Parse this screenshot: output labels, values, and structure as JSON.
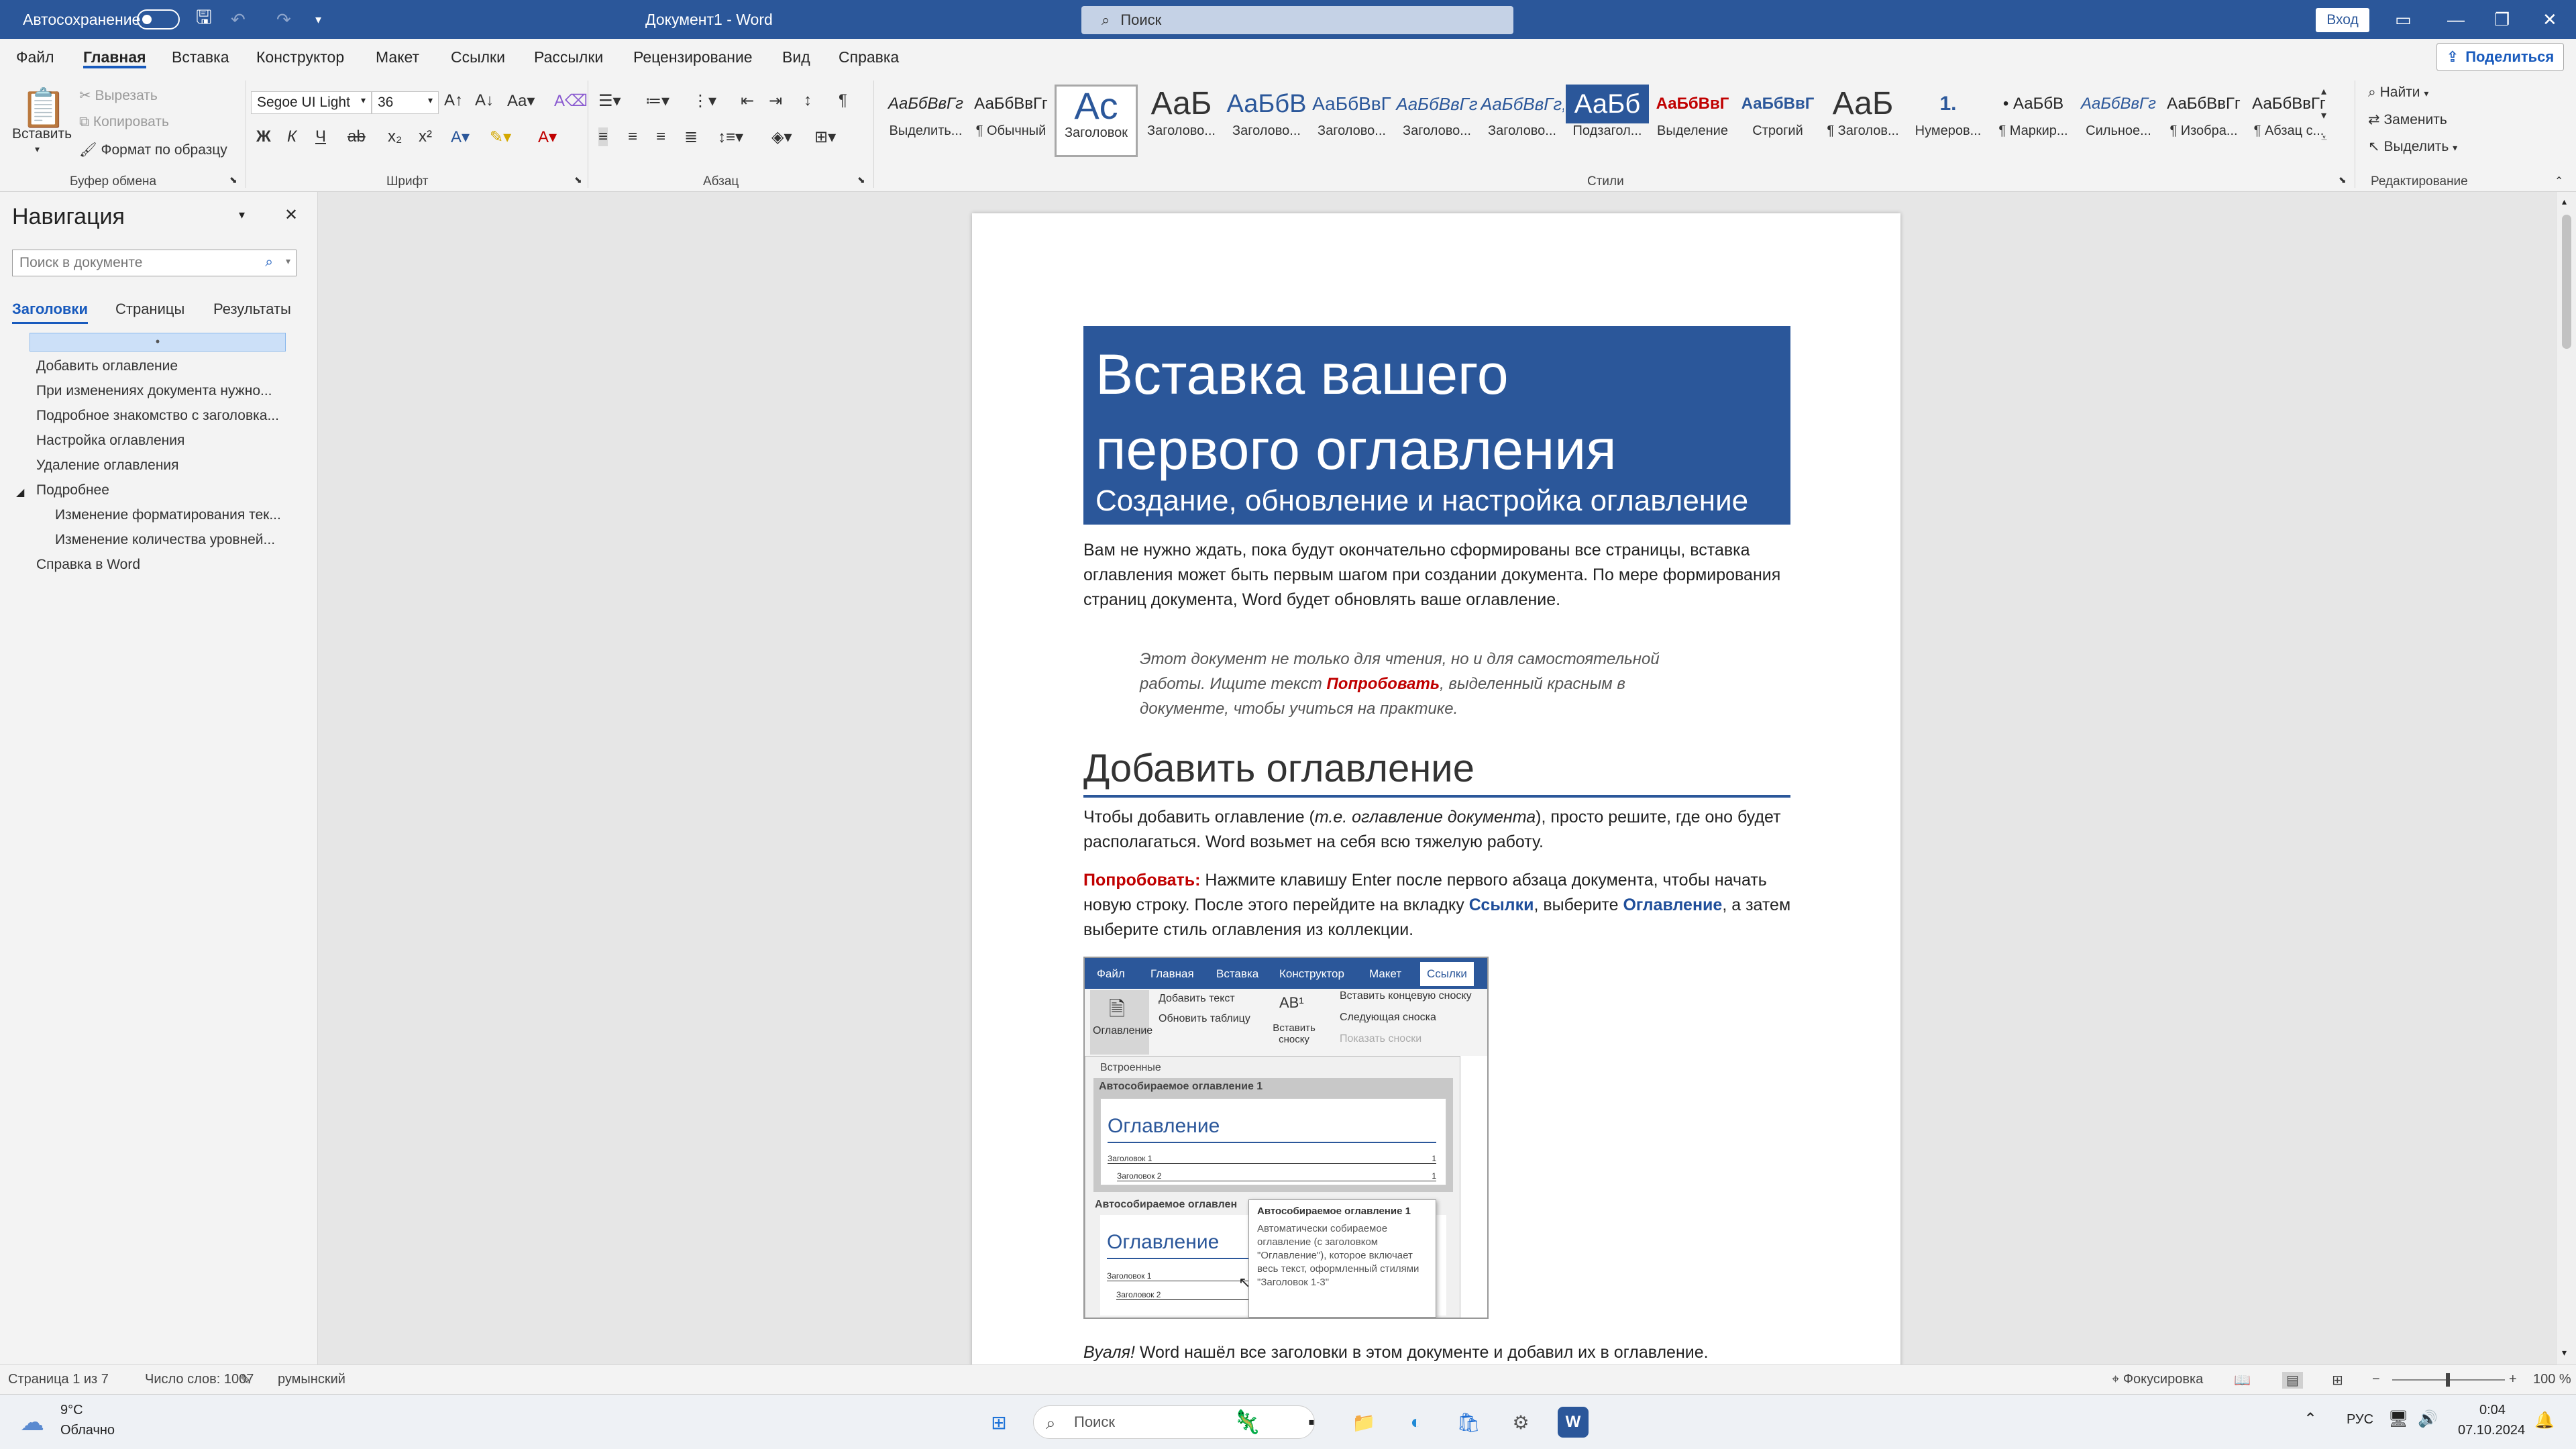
{
  "titlebar": {
    "autosave_label": "Автосохранение",
    "doc_title": "Документ1 - Word",
    "search_placeholder": "Поиск",
    "signin_label": "Вход"
  },
  "menu": {
    "tabs": [
      "Файл",
      "Главная",
      "Вставка",
      "Конструктор",
      "Макет",
      "Ссылки",
      "Рассылки",
      "Рецензирование",
      "Вид",
      "Справка"
    ],
    "active_tab": "Главная",
    "share_label": "Поделиться"
  },
  "ribbon": {
    "clipboard": {
      "paste": "Вставить",
      "cut": "Вырезать",
      "copy": "Копировать",
      "format_painter": "Формат по образцу",
      "group_label": "Буфер обмена"
    },
    "font": {
      "font_name": "Segoe UI Light",
      "font_size": "36",
      "group_label": "Шрифт"
    },
    "paragraph": {
      "group_label": "Абзац"
    },
    "styles": {
      "group_label": "Стили",
      "items": [
        {
          "preview": "АаБбВвГг",
          "name": "Выделить..."
        },
        {
          "preview": "АаБбВвГг",
          "name": "¶ Обычный"
        },
        {
          "preview": "Ac",
          "name": "Заголовок"
        },
        {
          "preview": "АаБ",
          "name": "Заголово..."
        },
        {
          "preview": "АаБбВ",
          "name": "Заголово..."
        },
        {
          "preview": "АаБбВвГ",
          "name": "Заголово..."
        },
        {
          "preview": "АаБбВвГг",
          "name": "Заголово..."
        },
        {
          "preview": "АаБбВвГг,",
          "name": "Заголово..."
        },
        {
          "preview": "АаБб",
          "name": "Подзагол..."
        },
        {
          "preview": "АаБбВвГ",
          "name": "Выделение"
        },
        {
          "preview": "АаБбВвГ",
          "name": "Строгий"
        },
        {
          "preview": "АаБ",
          "name": "¶ Заголов..."
        },
        {
          "preview": "1.",
          "name": "Нумеров..."
        },
        {
          "preview": "• АаБбВ",
          "name": "¶ Маркир..."
        },
        {
          "preview": "АаБбВвГг",
          "name": "Сильное..."
        },
        {
          "preview": "АаБбВвГг",
          "name": "¶ Изобра..."
        },
        {
          "preview": "АаБбВвГг",
          "name": "¶ Абзац с..."
        }
      ]
    },
    "editing": {
      "find": "Найти",
      "replace": "Заменить",
      "select": "Выделить",
      "group_label": "Редактирование"
    }
  },
  "nav": {
    "title": "Навигация",
    "search_placeholder": "Поиск в документе",
    "tabs": [
      "Заголовки",
      "Страницы",
      "Результаты"
    ],
    "selected_marker": "•",
    "items": [
      {
        "label": "Добавить оглавление",
        "level": 1
      },
      {
        "label": "При изменениях документа нужно...",
        "level": 1
      },
      {
        "label": "Подробное знакомство с заголовка...",
        "level": 1
      },
      {
        "label": "Настройка оглавления",
        "level": 1
      },
      {
        "label": "Удаление оглавления",
        "level": 1
      },
      {
        "label": "Подробнее",
        "level": 1
      },
      {
        "label": "Изменение форматирования тек...",
        "level": 2
      },
      {
        "label": "Изменение количества уровней...",
        "level": 2
      },
      {
        "label": "Справка в Word",
        "level": 1
      }
    ]
  },
  "doc": {
    "hero_line1": "Вставка вашего",
    "hero_line2": "первого оглавления",
    "hero_sub": "Создание, обновление и настройка оглавление",
    "intro": "Вам не нужно ждать, пока будут окончательно сформированы все страницы, вставка оглавления может быть первым шагом при создании документа. По мере формирования страниц документа, Word будет обновлять ваше оглавление.",
    "quote_before": "Этот документ не только для чтения, но и для самостоятельной работы. Ищите текст ",
    "quote_highlight": "Попробовать",
    "quote_after": ", выделенный красным в документе, чтобы учиться на практике.",
    "h1": "Добавить оглавление",
    "p1_a": "Чтобы добавить оглавление (",
    "p1_italic": "т.е. оглавление документа",
    "p1_b": "), просто решите, где оно будет располагаться. Word возьмет на себя всю тяжелую работу.",
    "try_label": "Попробовать:",
    "p2_a": " Нажмите клавишу Enter после первого абзаца документа, чтобы начать новую строку. После этого перейдите на вкладку ",
    "p2_link1": "Ссылки",
    "p2_b": ", выберите ",
    "p2_link2": "Оглавление",
    "p2_c": ", а затем выберите стиль оглавления из коллекции.",
    "voila_italic": "Вуаля!",
    "voila_rest": " Word нашёл все заголовки в этом документе и добавил их в оглавление."
  },
  "shot": {
    "tabs": [
      "Файл",
      "Главная",
      "Вставка",
      "Конструктор",
      "Макет",
      "Ссылки"
    ],
    "toc_btn": "Оглавление",
    "add_text": "Добавить текст",
    "update_table": "Обновить таблицу",
    "insert_footnote": "Вставить сноску",
    "insert_endnote": "Вставить концевую сноску",
    "next_footnote": "Следующая сноска",
    "show_notes": "Показать сноски",
    "builtin": "Встроенные",
    "auto1": "Автособираемое оглавление 1",
    "auto2": "Автособираемое оглавлен",
    "toc_heading": "Оглавление",
    "h1_line": "Заголовок 1",
    "h2_line": "Заголовок 2",
    "page_num": "1",
    "tooltip_title": "Автособираемое оглавление 1",
    "tooltip_body": "Автоматически собираемое оглавление (с заголовком \"Оглавление\"), которое включает весь текст, оформленный стилями \"Заголовок 1-3\""
  },
  "status": {
    "page": "Страница 1 из 7",
    "words": "Число слов: 1007",
    "language": "румынский",
    "focus": "Фокусировка",
    "zoom": "100 %"
  },
  "taskbar": {
    "temp": "9°C",
    "weather": "Облачно",
    "search_placeholder": "Поиск",
    "lang": "РУС",
    "time": "0:04",
    "date": "07.10.2024"
  }
}
